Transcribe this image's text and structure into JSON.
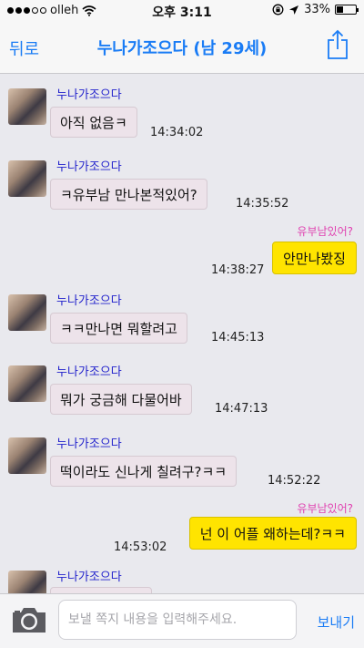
{
  "status_bar": {
    "carrier": "olleh",
    "time": "오후 3:11",
    "battery": "33%",
    "battery_level": 0.33
  },
  "nav": {
    "back_label": "뒤로",
    "title": "누나가조으다 (남 29세)"
  },
  "messages": [
    {
      "sender": "누나가조으다",
      "text": "아직 없음ㅋ",
      "time": "14:34:02"
    },
    {
      "sender": "누나가조으다",
      "text": "ㅋ유부남 만나본적있어?",
      "time": "14:35:52"
    },
    {
      "reader": "유부남있어?",
      "text": "안만나봤징",
      "time": "14:38:27"
    },
    {
      "sender": "누나가조으다",
      "text": "ㅋㅋ만나면 뭐할려고",
      "time": "14:45:13"
    },
    {
      "sender": "누나가조으다",
      "text": "뭐가 궁금해 다물어바",
      "time": "14:47:13"
    },
    {
      "sender": "누나가조으다",
      "text": "떡이라도 신나게 칠려구?ㅋㅋ",
      "time": "14:52:22"
    },
    {
      "reader": "유부남있어?",
      "text": "넌 이 어플 왜하는데?ㅋㅋ",
      "time": "14:53:02"
    },
    {
      "sender": "누나가조으다"
    }
  ],
  "input": {
    "placeholder": "보낼 쪽지 내용을 입력해주세요.",
    "send_label": "보내기"
  },
  "icons": [
    "signal-dots-icon",
    "wifi-icon",
    "rotation-lock-icon",
    "location-arrow-icon",
    "battery-icon",
    "share-icon",
    "camera-icon",
    "avatar"
  ],
  "colors": {
    "accent": "#1a7cf5",
    "sender_name": "#2222cc",
    "outgoing_bubble": "#ffe400",
    "incoming_bubble": "#ede3ea",
    "reader_label": "#e041b0"
  }
}
